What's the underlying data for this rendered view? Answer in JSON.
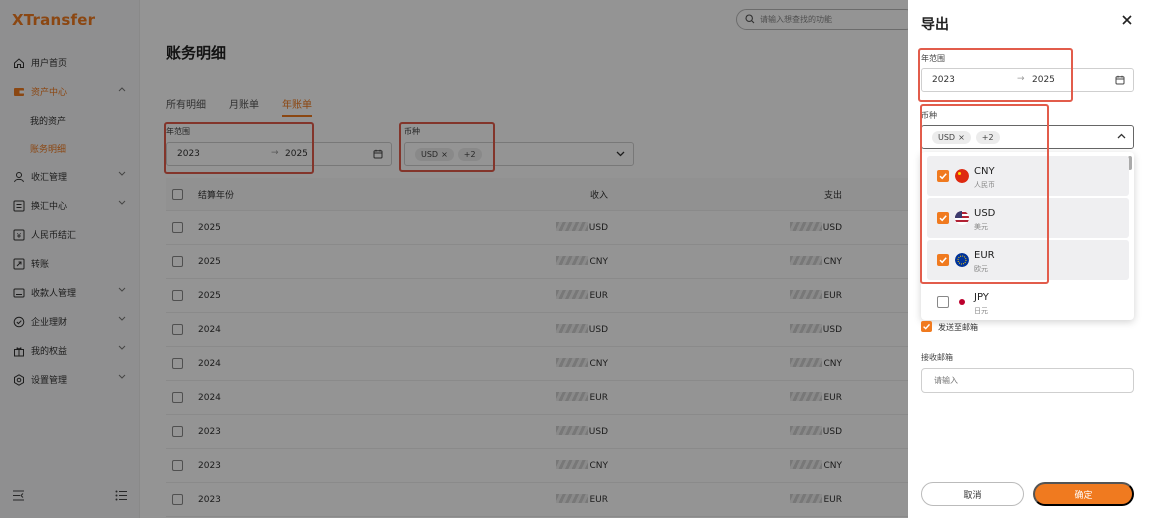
{
  "app": {
    "logo": "XTransfer"
  },
  "sidebar": {
    "items": [
      {
        "label": "用户首页",
        "icon": "home-icon"
      },
      {
        "label": "资产中心",
        "icon": "wallet-icon",
        "expanded": true,
        "active": true,
        "children": [
          {
            "label": "我的资产"
          },
          {
            "label": "账务明细",
            "active": true
          }
        ]
      },
      {
        "label": "收汇管理",
        "icon": "person-icon"
      },
      {
        "label": "换汇中心",
        "icon": "exchange-icon"
      },
      {
        "label": "人民币结汇",
        "icon": "yuan-icon"
      },
      {
        "label": "转账",
        "icon": "transfer-icon"
      },
      {
        "label": "收款人管理",
        "icon": "contacts-icon"
      },
      {
        "label": "企业理财",
        "icon": "finance-icon"
      },
      {
        "label": "我的权益",
        "icon": "gift-icon"
      },
      {
        "label": "设置管理",
        "icon": "settings-icon"
      }
    ]
  },
  "header": {
    "search_placeholder": "请输入想查找的功能"
  },
  "page": {
    "title": "账务明细",
    "tabs": [
      {
        "label": "所有明细"
      },
      {
        "label": "月账单"
      },
      {
        "label": "年账单",
        "active": true
      }
    ],
    "filters": {
      "year_range_label": "年范围",
      "year_from": "2023",
      "year_to": "2025",
      "currency_label": "币种",
      "currency_tag": "USD",
      "currency_more": "+2"
    },
    "table": {
      "headers": {
        "year": "结算年份",
        "income": "收入",
        "expense": "支出"
      },
      "rows": [
        {
          "year": "2025",
          "income_cur": "USD",
          "expense_cur": "USD"
        },
        {
          "year": "2025",
          "income_cur": "CNY",
          "expense_cur": "CNY"
        },
        {
          "year": "2025",
          "income_cur": "EUR",
          "expense_cur": "EUR"
        },
        {
          "year": "2024",
          "income_cur": "USD",
          "expense_cur": "USD"
        },
        {
          "year": "2024",
          "income_cur": "CNY",
          "expense_cur": "CNY"
        },
        {
          "year": "2024",
          "income_cur": "EUR",
          "expense_cur": "EUR"
        },
        {
          "year": "2023",
          "income_cur": "USD",
          "expense_cur": "USD"
        },
        {
          "year": "2023",
          "income_cur": "CNY",
          "expense_cur": "CNY"
        },
        {
          "year": "2023",
          "income_cur": "EUR",
          "expense_cur": "EUR"
        }
      ]
    }
  },
  "export_panel": {
    "title": "导出",
    "year_range_label": "年范围",
    "year_from": "2023",
    "year_to": "2025",
    "currency_label": "币种",
    "currency_tag": "USD",
    "currency_more": "+2",
    "options": [
      {
        "code": "CNY",
        "name": "人民币",
        "checked": true
      },
      {
        "code": "USD",
        "name": "美元",
        "checked": true
      },
      {
        "code": "EUR",
        "name": "欧元",
        "checked": true
      },
      {
        "code": "JPY",
        "name": "日元",
        "checked": false
      }
    ],
    "send_email_label": "发送至邮箱",
    "send_email_checked": true,
    "email_label": "接收邮箱",
    "email_placeholder": "请输入",
    "cancel_label": "取消",
    "confirm_label": "确定"
  },
  "colors": {
    "accent": "#f07a1f",
    "highlight_border": "#e25c4b"
  }
}
